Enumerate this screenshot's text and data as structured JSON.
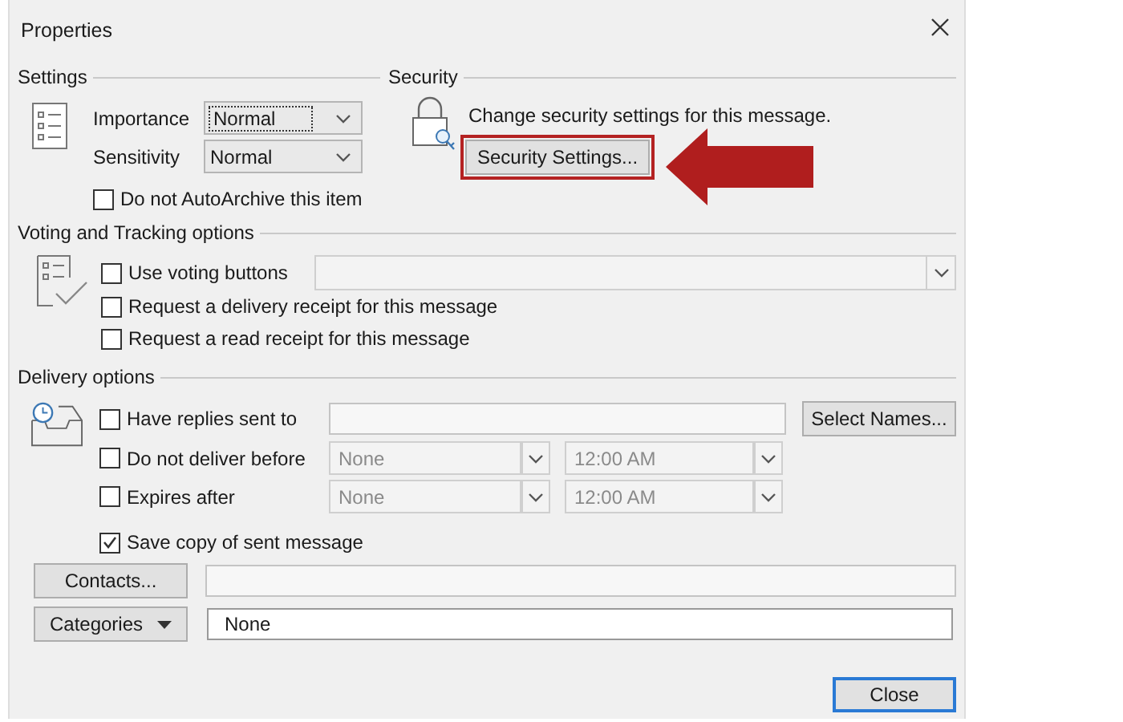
{
  "window": {
    "title": "Properties"
  },
  "settings": {
    "heading": "Settings",
    "fields": [
      {
        "label": "Importance",
        "value": "Normal",
        "focused": true
      },
      {
        "label": "Sensitivity",
        "value": "Normal",
        "focused": false
      }
    ],
    "autoarchive": {
      "label": "Do not AutoArchive this item",
      "checked": false
    }
  },
  "security": {
    "heading": "Security",
    "text": "Change security settings for this message.",
    "button": "Security Settings...",
    "highlighted": true
  },
  "voting": {
    "heading": "Voting and Tracking options",
    "use_voting": {
      "label": "Use voting buttons",
      "checked": false
    },
    "receipts": [
      {
        "label": "Request a delivery receipt for this message",
        "checked": false
      },
      {
        "label": "Request a read receipt for this message",
        "checked": false
      }
    ]
  },
  "delivery": {
    "heading": "Delivery options",
    "replies": {
      "label": "Have replies sent to",
      "checked": false
    },
    "select_names": "Select Names...",
    "schedule": [
      {
        "label": "Do not deliver before",
        "checked": false,
        "date": "None",
        "time": "12:00 AM",
        "disabled": true
      },
      {
        "label": "Expires after",
        "checked": false,
        "date": "None",
        "time": "12:00 AM",
        "disabled": true
      }
    ],
    "save_copy": {
      "label": "Save copy of sent message",
      "checked": true
    }
  },
  "contacts": {
    "button": "Contacts..."
  },
  "categories": {
    "button": "Categories",
    "value": "None"
  },
  "buttons": [
    {
      "label": "Close",
      "default": true
    }
  ]
}
